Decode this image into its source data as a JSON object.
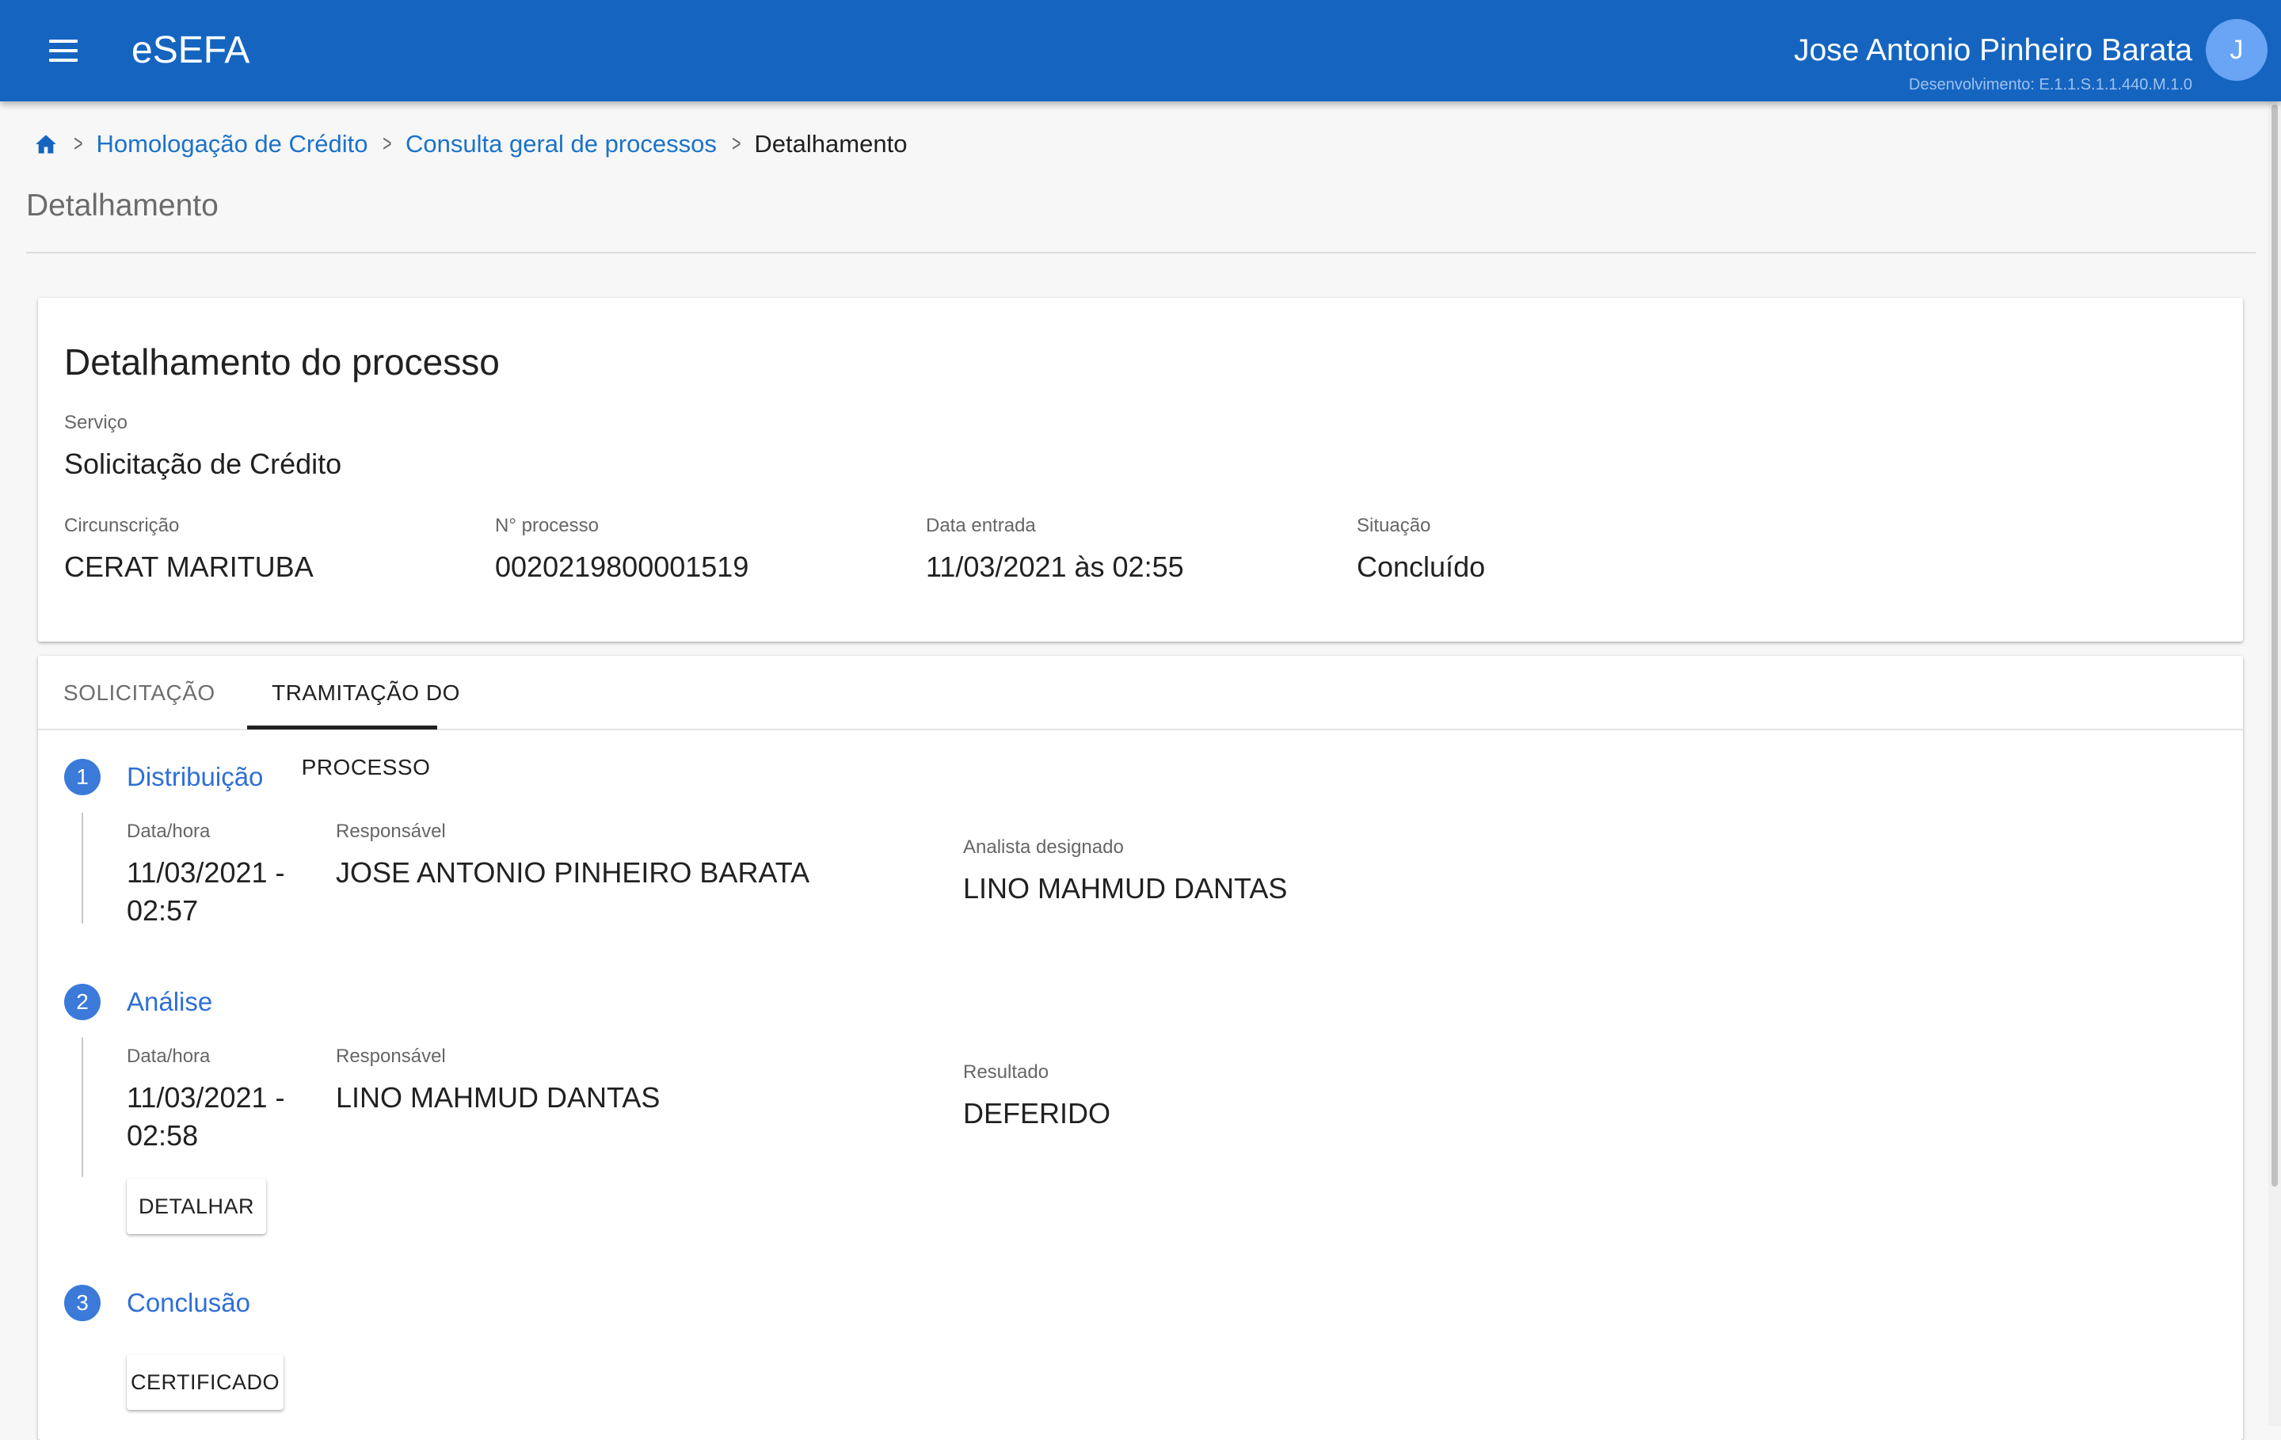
{
  "header": {
    "app_title": "eSEFA",
    "user_name": "Jose Antonio Pinheiro Barata",
    "environment": "Desenvolvimento: E.1.1.S.1.1.440.M.1.0",
    "avatar_letter": "J"
  },
  "breadcrumb": {
    "items": [
      "Homologação de Crédito",
      "Consulta geral de processos"
    ],
    "current": "Detalhamento"
  },
  "page": {
    "title": "Detalhamento"
  },
  "details": {
    "title": "Detalhamento do processo",
    "servico": {
      "label": "Serviço",
      "value": "Solicitação de Crédito"
    },
    "circunscricao": {
      "label": "Circunscrição",
      "value": "CERAT MARITUBA"
    },
    "processo": {
      "label": "N° processo",
      "value": "0020219800001519"
    },
    "data_entrada": {
      "label": "Data entrada",
      "value": "11/03/2021 às 02:55"
    },
    "situacao": {
      "label": "Situação",
      "value": "Concluído"
    }
  },
  "tabs": {
    "items": [
      {
        "label": "SOLICITAÇÃO",
        "active": false
      },
      {
        "label": "TRAMITAÇÃO DO PROCESSO",
        "active": true
      }
    ]
  },
  "steps": [
    {
      "number": "1",
      "title": "Distribuição",
      "datahora": {
        "label": "Data/hora",
        "value": "11/03/2021 - 02:57"
      },
      "responsavel": {
        "label": "Responsável",
        "value": "JOSE ANTONIO PINHEIRO BARATA"
      },
      "extra": {
        "label": "Analista designado",
        "value": "LINO MAHMUD DANTAS"
      }
    },
    {
      "number": "2",
      "title": "Análise",
      "datahora": {
        "label": "Data/hora",
        "value": "11/03/2021 - 02:58"
      },
      "responsavel": {
        "label": "Responsável",
        "value": "LINO MAHMUD DANTAS"
      },
      "extra": {
        "label": "Resultado",
        "value": "DEFERIDO"
      },
      "button": "DETALHAR"
    },
    {
      "number": "3",
      "title": "Conclusão",
      "button": "CERTIFICADO"
    }
  ],
  "colors": {
    "appbar": "#1565c0",
    "link": "#1a73c8",
    "step_accent": "#3b7ad9"
  }
}
